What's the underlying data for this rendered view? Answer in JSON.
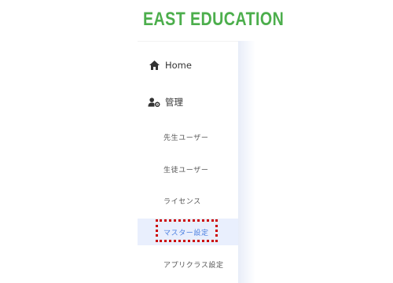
{
  "brand": {
    "logo_text": "EAST EDUCATION",
    "color": "#4cae4c"
  },
  "sidebar": {
    "items": [
      {
        "label": "Home",
        "icon": "home-icon"
      },
      {
        "label": "管理",
        "icon": "user-gear-icon"
      }
    ],
    "sub_items": [
      {
        "label": "先生ユーザー",
        "active": false
      },
      {
        "label": "生徒ユーザー",
        "active": false
      },
      {
        "label": "ライセンス",
        "active": false
      },
      {
        "label": "マスター設定",
        "active": true
      },
      {
        "label": "アプリクラス設定",
        "active": false
      }
    ]
  },
  "colors": {
    "active_background": "#e9effd",
    "active_text": "#4a7fe0",
    "highlight_border": "#cc0000"
  }
}
